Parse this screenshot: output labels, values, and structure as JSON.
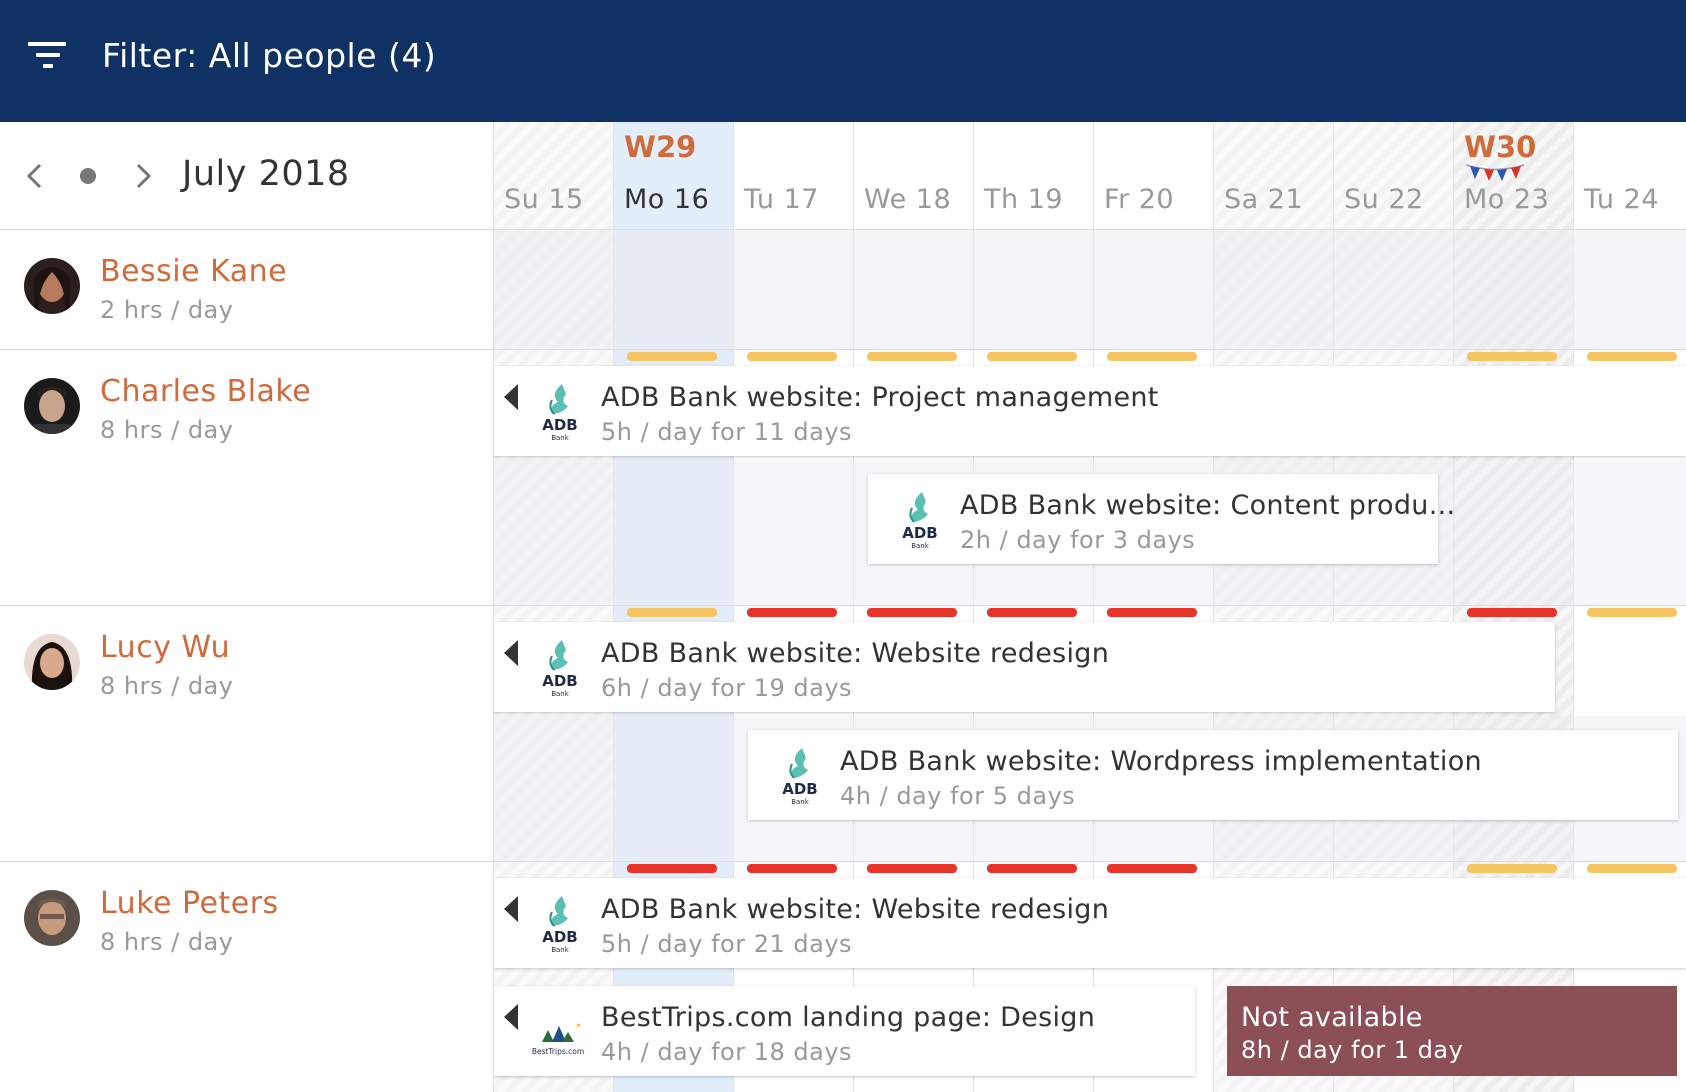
{
  "header": {
    "filter_label": "Filter: All people (4)"
  },
  "calendar": {
    "month_label": "July 2018",
    "weeks": [
      "W29",
      "W30"
    ],
    "days": [
      "Su 15",
      "Mo 16",
      "Tu 17",
      "We 18",
      "Th 19",
      "Fr 20",
      "Sa 21",
      "Su 22",
      "Mo 23",
      "Tu 24"
    ]
  },
  "people": [
    {
      "name": "Bessie Kane",
      "hours": "2 hrs / day"
    },
    {
      "name": "Charles Blake",
      "hours": "8 hrs / day"
    },
    {
      "name": "Lucy Wu",
      "hours": "8 hrs / day"
    },
    {
      "name": "Luke Peters",
      "hours": "8 hrs / day"
    }
  ],
  "tasks": [
    {
      "title": "ADB Bank website: Project management",
      "detail": "5h / day for 11 days",
      "client_logo": "ADB",
      "logo_sub": "Bank"
    },
    {
      "title": "ADB Bank website: Content produ...",
      "detail": "2h / day for 3 days",
      "client_logo": "ADB",
      "logo_sub": "Bank"
    },
    {
      "title": "ADB Bank website: Website redesign",
      "detail": "6h / day for 19 days",
      "client_logo": "ADB",
      "logo_sub": "Bank"
    },
    {
      "title": "ADB Bank website: Wordpress implementation",
      "detail": "4h / day for 5 days",
      "client_logo": "ADB",
      "logo_sub": "Bank"
    },
    {
      "title": "ADB Bank website: Website redesign",
      "detail": "5h / day for 21 days",
      "client_logo": "ADB",
      "logo_sub": "Bank"
    },
    {
      "title": "BestTrips.com landing page: Design",
      "detail": "4h / day for 18 days",
      "client_logo": "BestTrips.com"
    }
  ],
  "time_off": {
    "title": "Not available",
    "detail": "8h / day for 1 day"
  },
  "capacity_colors": {
    "partial": "#f5c563",
    "full": "#e8332a"
  },
  "colors": {
    "header_bg": "#0f3164",
    "accent": "#cf6a3b",
    "time_off": "#8b4f55"
  }
}
